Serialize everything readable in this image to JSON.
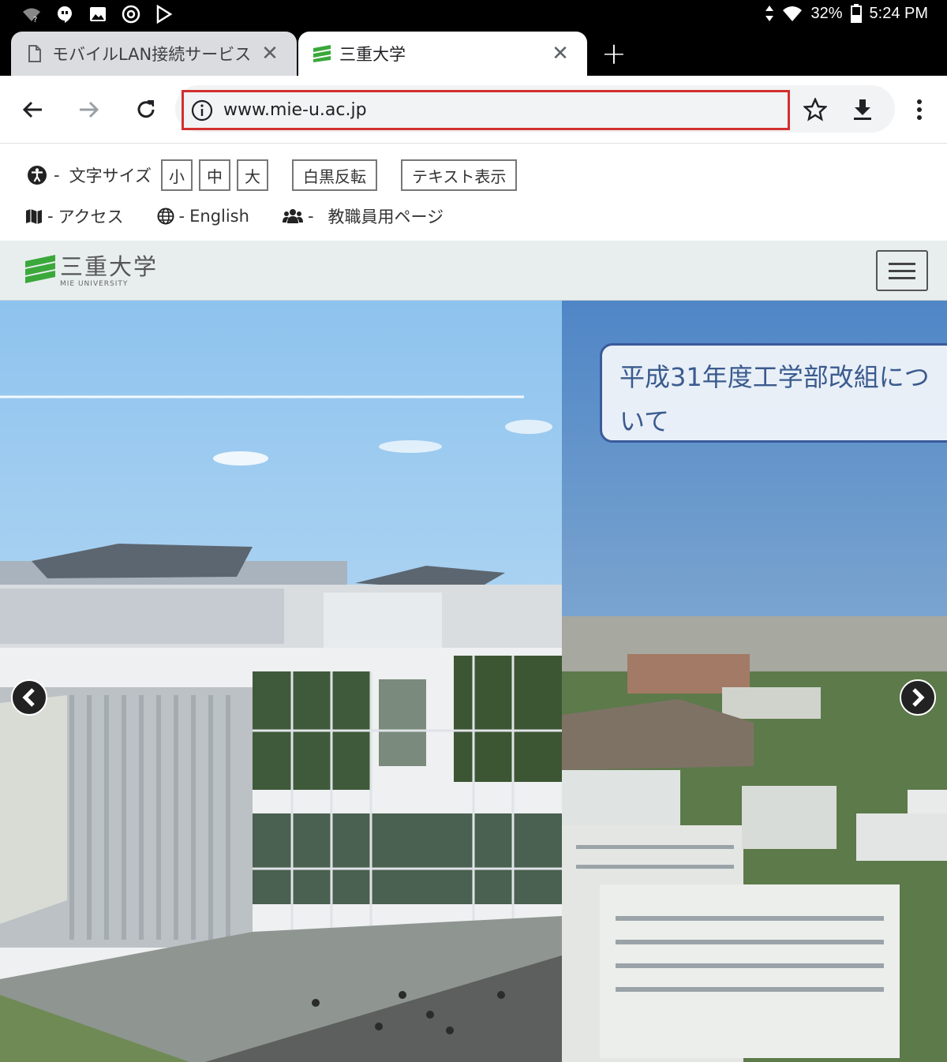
{
  "status_bar": {
    "battery": "32%",
    "time": "5:24 PM"
  },
  "tabs": [
    {
      "title": "モバイルLAN接続サービス -",
      "close": "✕"
    },
    {
      "title": "三重大学",
      "close": "✕"
    }
  ],
  "new_tab_label": "+",
  "toolbar": {
    "url": "www.mie-u.ac.jp"
  },
  "a11y": {
    "text_size_label": "文字サイズ",
    "size_small": "小",
    "size_medium": "中",
    "size_large": "大",
    "invert_button": "白黒反転",
    "text_view_button": "テキスト表示",
    "dash": "-"
  },
  "nav": {
    "access": "アクセス",
    "english": "English",
    "staff": "教職員用ページ"
  },
  "site": {
    "logo_jp": "三重大学",
    "logo_en": "MIE UNIVERSITY"
  },
  "hero": {
    "caption": "平成31年度工学部改組について"
  },
  "colors": {
    "url_highlight": "#d32f2f",
    "caption_border": "#3a5a9a",
    "logo_green": "#3aa83a"
  }
}
